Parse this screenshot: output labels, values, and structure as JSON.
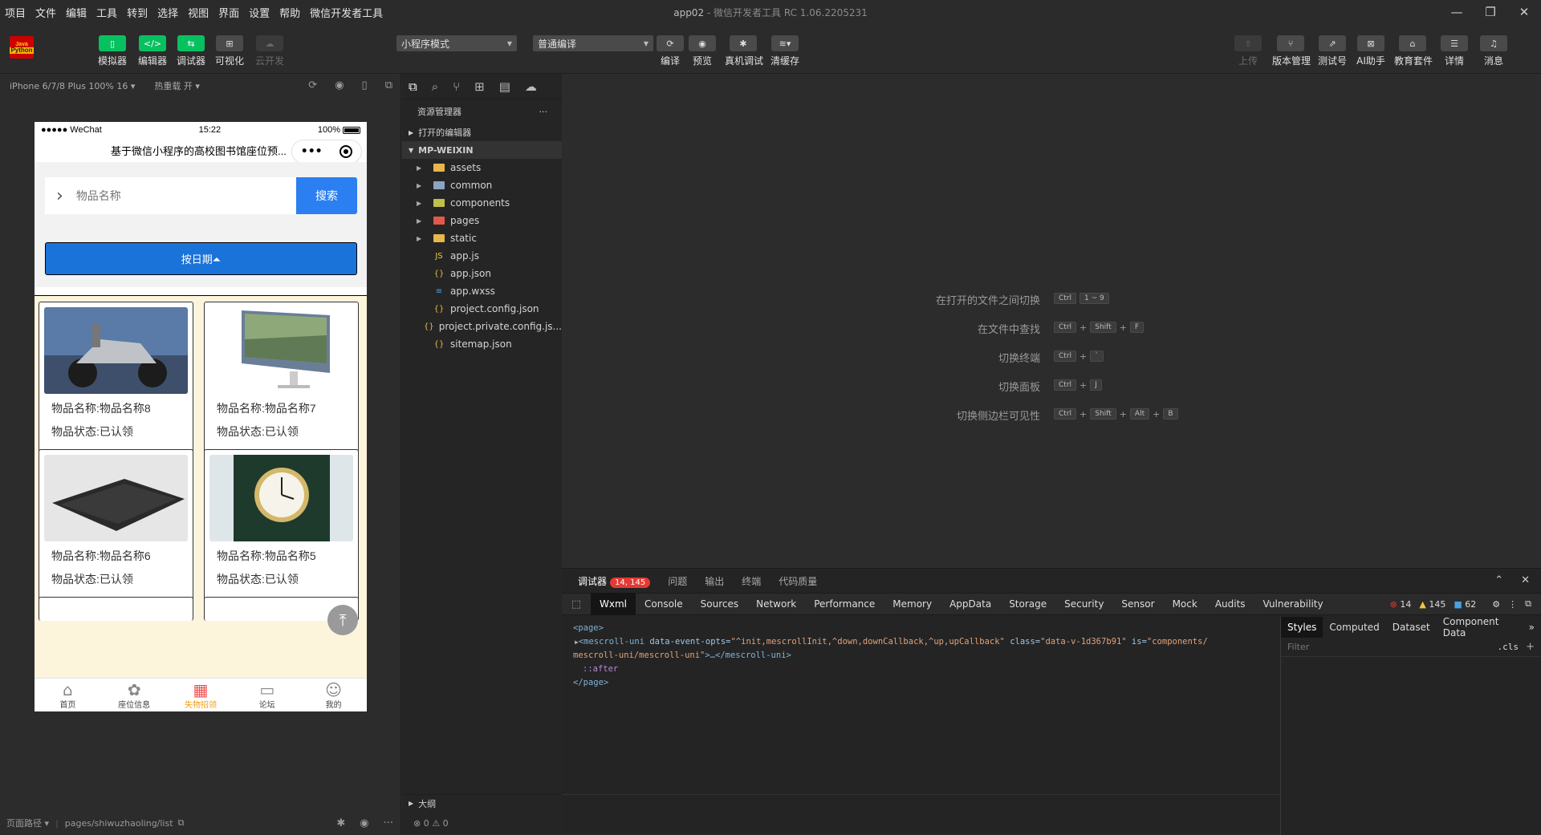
{
  "menu": [
    "项目",
    "文件",
    "编辑",
    "工具",
    "转到",
    "选择",
    "视图",
    "界面",
    "设置",
    "帮助",
    "微信开发者工具"
  ],
  "window": {
    "title": "app02",
    "subtitle": " - 微信开发者工具 RC 1.06.2205231",
    "min": "—",
    "max": "❐",
    "close": "✕"
  },
  "logo": {
    "line1": "Java",
    "line2": "Python"
  },
  "toolbar": {
    "simulator": "模拟器",
    "editor": "编辑器",
    "debugger": "调试器",
    "visual": "可视化",
    "cloud": "云开发",
    "mode_select": "小程序模式",
    "compile_select": "普通编译",
    "compile": "编译",
    "preview": "预览",
    "remote_debug": "真机调试",
    "clear_cache": "清缓存",
    "upload": "上传",
    "version": "版本管理",
    "test": "测试号",
    "ai": "AI助手",
    "edu": "教育套件",
    "detail": "详情",
    "msg": "消息"
  },
  "simulator": {
    "device": "iPhone 6/7/8 Plus 100% 16 ▾",
    "hot_reload": "热重载 开 ▾"
  },
  "phone": {
    "carrier": "●●●●● WeChat",
    "time": "15:22",
    "battery": "100%",
    "nav_title": "基于微信小程序的高校图书馆座位预...",
    "search_placeholder": "物品名称",
    "search_button": "搜索",
    "date_button": "按日期⏶",
    "items": [
      {
        "name": "物品名称:物品名称8",
        "status": "物品状态:已认领"
      },
      {
        "name": "物品名称:物品名称7",
        "status": "物品状态:已认领"
      },
      {
        "name": "物品名称:物品名称6",
        "status": "物品状态:已认领"
      },
      {
        "name": "物品名称:物品名称5",
        "status": "物品状态:已认领"
      }
    ],
    "tabs": [
      "首页",
      "座位信息",
      "失物招领",
      "论坛",
      "我的"
    ]
  },
  "page_path": {
    "label": "页面路径 ▾",
    "path": "pages/shiwuzhaoling/list"
  },
  "explorer": {
    "title": "资源管理器",
    "more": "···",
    "open_editors": "打开的编辑器",
    "project": "MP-WEIXIN",
    "folders": [
      "assets",
      "common",
      "components",
      "pages",
      "static"
    ],
    "files": [
      "app.js",
      "app.json",
      "app.wxss",
      "project.config.json",
      "project.private.config.js...",
      "sitemap.json"
    ],
    "outline": "大纲",
    "status": "⊗ 0 ⚠ 0"
  },
  "shortcuts": [
    {
      "label": "在打开的文件之间切换",
      "keys": [
        "Ctrl",
        "1 ~ 9"
      ]
    },
    {
      "label": "在文件中查找",
      "keys": [
        "Ctrl",
        "Shift",
        "F"
      ]
    },
    {
      "label": "切换终端",
      "keys": [
        "Ctrl",
        "`"
      ]
    },
    {
      "label": "切换面板",
      "keys": [
        "Ctrl",
        "J"
      ]
    },
    {
      "label": "切换侧边栏可见性",
      "keys": [
        "Ctrl",
        "Shift",
        "Alt",
        "B"
      ]
    }
  ],
  "devtools": {
    "tabs": [
      "调试器",
      "问题",
      "输出",
      "终端",
      "代码质量"
    ],
    "badge": "14, 145",
    "panels": [
      "Wxml",
      "Console",
      "Sources",
      "Network",
      "Performance",
      "Memory",
      "AppData",
      "Storage",
      "Security",
      "Sensor",
      "Mock",
      "Audits",
      "Vulnerability"
    ],
    "errors": "14",
    "warnings": "145",
    "infos": "62",
    "code": {
      "l1": "<page>",
      "l2_tag": "<mescroll-uni ",
      "l2_attr1": "data-event-opts=",
      "l2_val1": "\"^init,mescrollInit,^down,downCallback,^up,upCallback\"",
      "l2_attr2": " class=",
      "l2_val2": "\"data-v-1d367b91\"",
      "l2_attr3": " is=",
      "l2_val3": "\"components/",
      "l3_val": "mescroll-uni/mescroll-uni\"",
      "l3_tail": ">…</mescroll-uni>",
      "l4": "::after",
      "l5": "</page>"
    },
    "styles_tabs": [
      "Styles",
      "Computed",
      "Dataset",
      "Component Data"
    ],
    "filter": "Filter",
    "cls": ".cls"
  }
}
